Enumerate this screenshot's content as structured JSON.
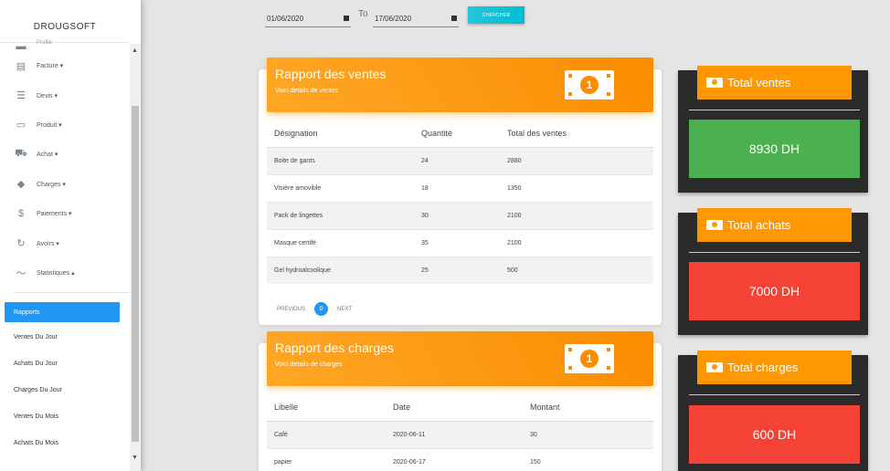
{
  "app": {
    "brand": "DROUGSOFT"
  },
  "sidebar": {
    "items": [
      {
        "label": "Profile",
        "icon": "person-icon"
      },
      {
        "label": "Facture ▾",
        "icon": "invoice-icon"
      },
      {
        "label": "Devis ▾",
        "icon": "list-icon"
      },
      {
        "label": "Produit ▾",
        "icon": "box-icon"
      },
      {
        "label": "Achat ▾",
        "icon": "cart-icon"
      },
      {
        "label": "Charges ▾",
        "icon": "tag-icon"
      },
      {
        "label": "Paiements ▾",
        "icon": "dollar-icon"
      },
      {
        "label": "Avoirs ▾",
        "icon": "refresh-icon"
      },
      {
        "label": "Statistiques ▴",
        "icon": "chart-line-icon"
      }
    ],
    "active": "Rapports",
    "sub_items": [
      "Ventes Du Jour",
      "Achats Du Jour",
      "Charges Du Jour",
      "Ventes Du Mois",
      "Achats Du Mois"
    ]
  },
  "filter": {
    "date_from": "01/06/2020",
    "to_label": "To",
    "date_to": "17/06/2020",
    "search_label": "CHERCHER"
  },
  "sales_report": {
    "title": "Rapport des ventes",
    "subtitle": "Voici details de ventes",
    "icon_glyph": "1",
    "columns": [
      "Désignation",
      "Quantité",
      "Total des ventes"
    ],
    "rows": [
      [
        "Boite de gants",
        "24",
        "2880"
      ],
      [
        "Visière amovible",
        "18",
        "1350"
      ],
      [
        "Pack de lingettes",
        "30",
        "2100"
      ],
      [
        "Masque certifé",
        "35",
        "2100"
      ],
      [
        "Gel hydroalcoolique",
        "25",
        "500"
      ]
    ],
    "pagination": {
      "previous": "PREVIOUS",
      "page": "0",
      "next": "NEXT"
    }
  },
  "charges_report": {
    "title": "Rapport des charges",
    "subtitle": "Voici details de charges",
    "icon_glyph": "1",
    "columns": [
      "Libelle",
      "Date",
      "Montant"
    ],
    "rows": [
      [
        "Café",
        "2020-06-11",
        "30"
      ],
      [
        "papier",
        "2020-06-17",
        "150"
      ]
    ]
  },
  "totals": [
    {
      "label": "Total ventes",
      "value": "8930 DH",
      "color": "#4caf50"
    },
    {
      "label": "Total achats",
      "value": "7000 DH",
      "color": "#f44336"
    },
    {
      "label": "Total charges",
      "value": "600 DH",
      "color": "#f44336"
    }
  ]
}
